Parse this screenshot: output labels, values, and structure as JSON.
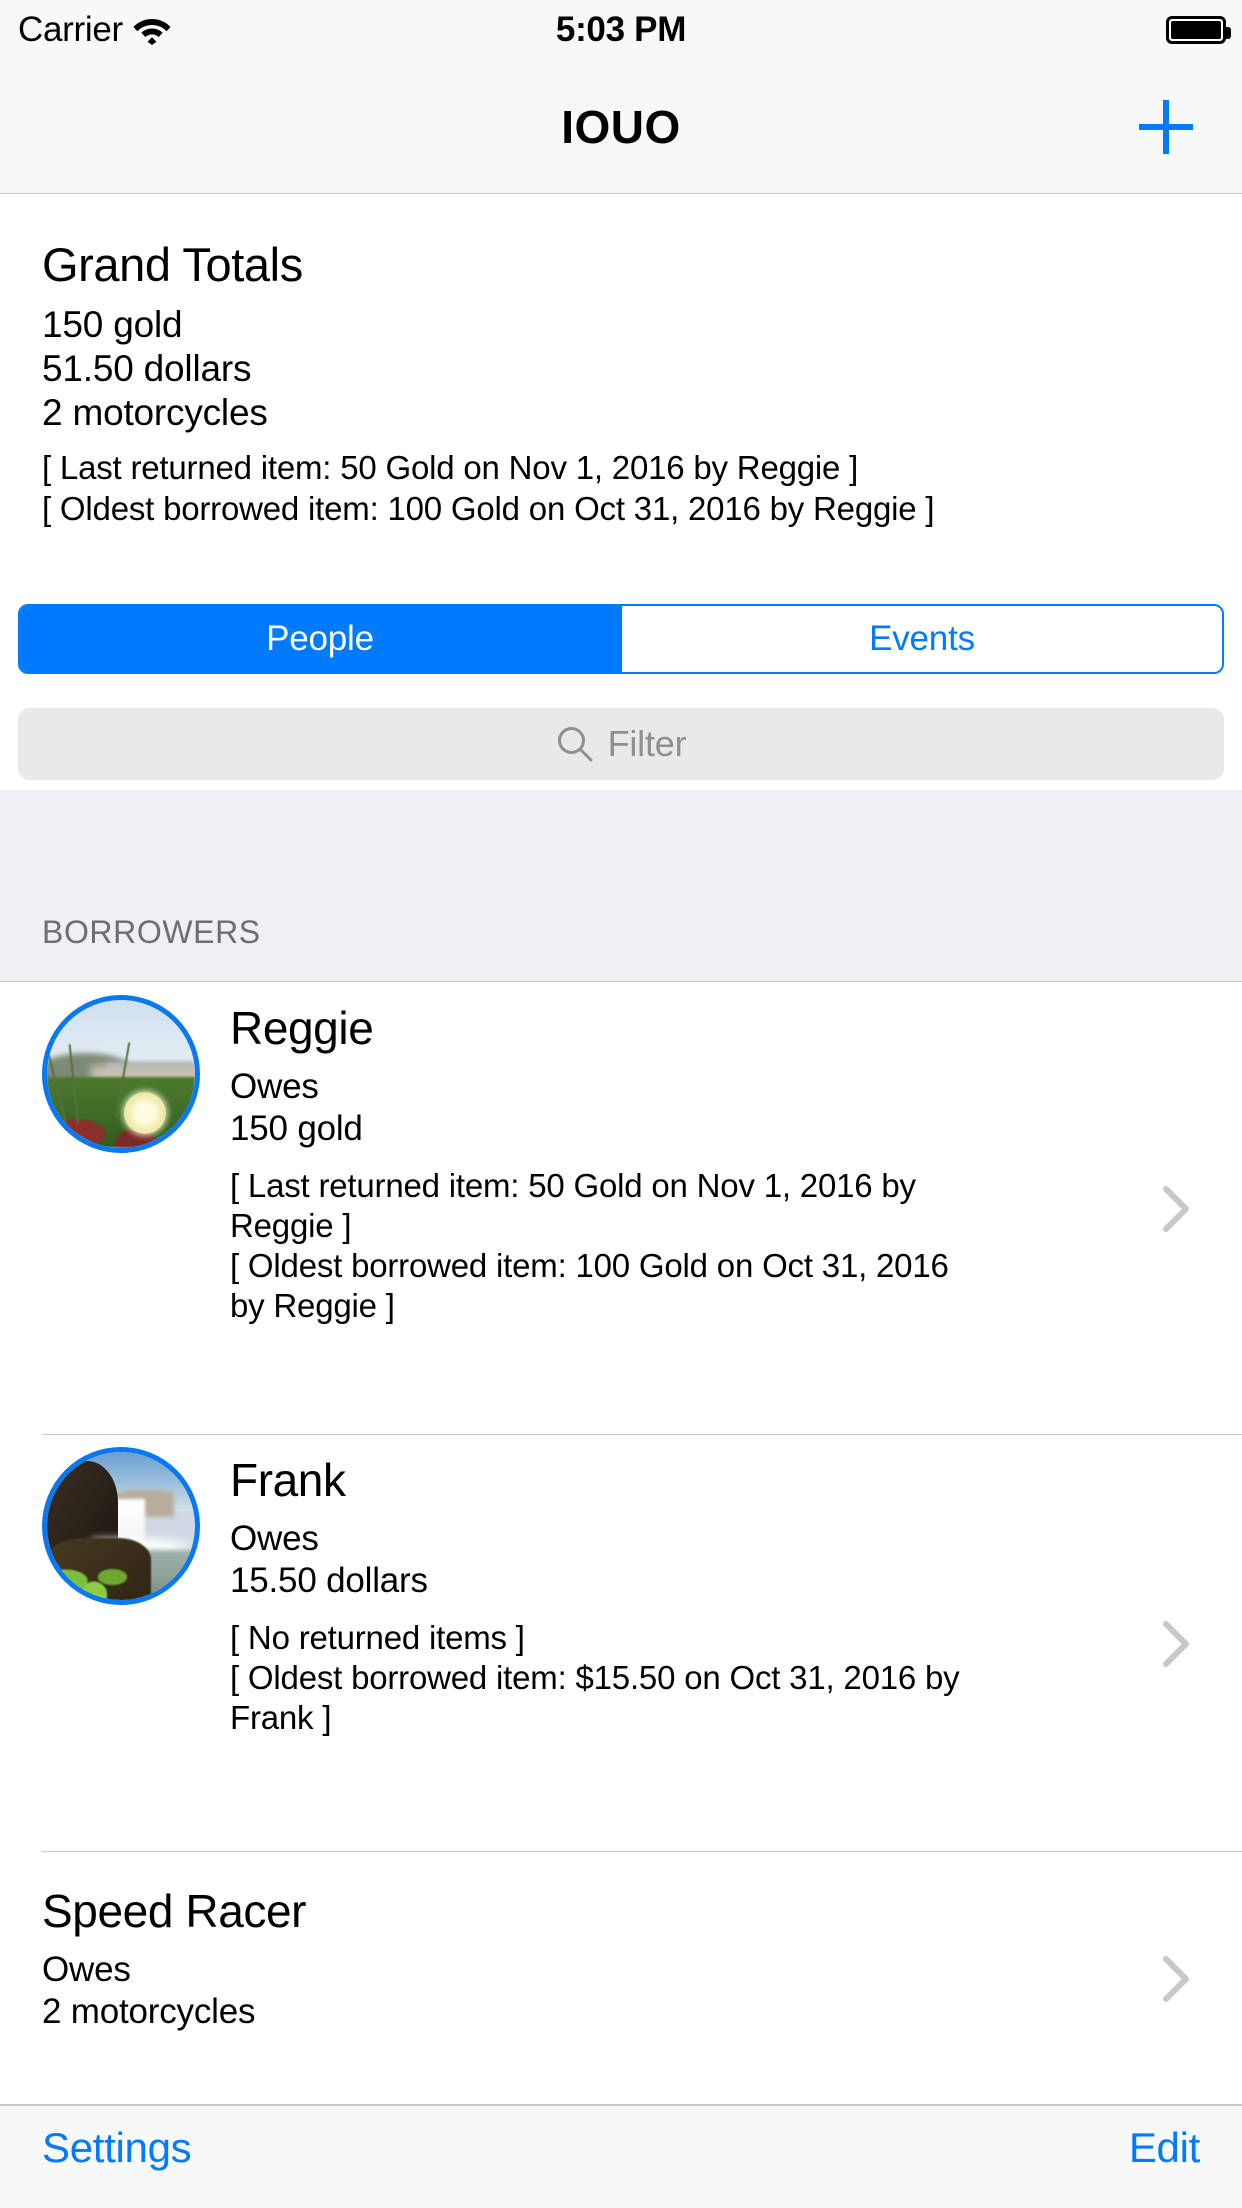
{
  "status_bar": {
    "carrier": "Carrier",
    "wifi_icon": "wifi-icon",
    "time": "5:03 PM",
    "battery_icon": "battery-full-icon"
  },
  "nav_bar": {
    "title": "IOUO",
    "add_icon": "plus-icon"
  },
  "totals": {
    "title": "Grand Totals",
    "amounts": [
      "150 gold",
      "51.50 dollars",
      "2 motorcycles"
    ],
    "notes": [
      "[ Last returned item: 50 Gold on Nov 1, 2016 by Reggie ]",
      "[ Oldest borrowed item: 100 Gold on Oct 31, 2016 by Reggie ]"
    ]
  },
  "segmented_control": {
    "selected_index": 0,
    "segments": [
      {
        "label": "People"
      },
      {
        "label": "Events"
      }
    ]
  },
  "filter": {
    "placeholder": "Filter",
    "value": "",
    "search_icon": "search-icon"
  },
  "section": {
    "header": "BORROWERS"
  },
  "people": [
    {
      "name": "Reggie",
      "owes_label": "Owes",
      "owes_amount": "150 gold",
      "avatar": "photo-coastal-flower",
      "notes": [
        "[ Last returned item: 50 Gold on Nov 1, 2016 by Reggie ]",
        "[ Oldest borrowed item: 100 Gold on Oct 31, 2016 by Reggie ]"
      ],
      "disclosure_icon": "chevron-right-icon"
    },
    {
      "name": "Frank",
      "owes_label": "Owes",
      "owes_amount": "15.50 dollars",
      "avatar": "photo-waterfall",
      "notes": [
        "[ No returned items ]",
        "[ Oldest borrowed item: $15.50 on Oct 31, 2016 by Frank ]"
      ],
      "disclosure_icon": "chevron-right-icon"
    },
    {
      "name": "Speed Racer",
      "owes_label": "Owes",
      "owes_amount": "2 motorcycles",
      "avatar": null,
      "notes": [],
      "disclosure_icon": "chevron-right-icon"
    }
  ],
  "toolbar": {
    "settings_label": "Settings",
    "edit_label": "Edit"
  },
  "colors": {
    "accent_blue": "#007AFF",
    "avatar_border": "#0A78F0",
    "separator": "#C8C7CC",
    "section_bg": "#EFEFF4",
    "chrome_bg": "#F8F8F8",
    "placeholder_gray": "#8E8E93",
    "section_label_gray": "#6D6D72",
    "chevron_gray": "#C7C7CC",
    "search_field_bg": "#E9E9EB"
  }
}
